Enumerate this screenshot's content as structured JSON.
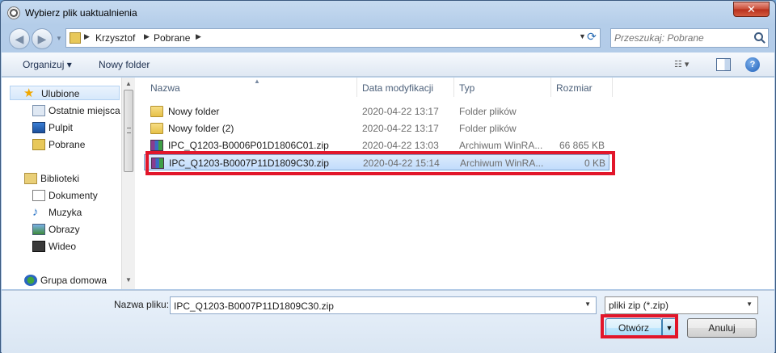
{
  "window": {
    "title": "Wybierz plik uaktualnienia",
    "close_label": "✕"
  },
  "navbar": {
    "back_icon": "back-arrow-icon",
    "forward_icon": "forward-arrow-icon",
    "breadcrumb": [
      "Krzysztof",
      "Pobrane"
    ],
    "search_placeholder": "Przeszukaj: Pobrane"
  },
  "toolbar": {
    "organize_label": "Organizuj ▾",
    "new_folder_label": "Nowy folder",
    "help_label": "?"
  },
  "sidebar": {
    "items": [
      {
        "label": "Ulubione",
        "icon": "star-icon",
        "selected": true
      },
      {
        "label": "Ostatnie miejsca",
        "icon": "recent-places-icon"
      },
      {
        "label": "Pulpit",
        "icon": "desktop-icon"
      },
      {
        "label": "Pobrane",
        "icon": "downloads-icon"
      },
      {
        "label": "Biblioteki",
        "icon": "libraries-icon"
      },
      {
        "label": "Dokumenty",
        "icon": "documents-icon"
      },
      {
        "label": "Muzyka",
        "icon": "music-icon"
      },
      {
        "label": "Obrazy",
        "icon": "pictures-icon"
      },
      {
        "label": "Wideo",
        "icon": "video-icon"
      },
      {
        "label": "Grupa domowa",
        "icon": "homegroup-icon"
      }
    ]
  },
  "files": {
    "columns": [
      "Nazwa",
      "Data modyfikacji",
      "Typ",
      "Rozmiar"
    ],
    "rows": [
      {
        "name": "Nowy folder",
        "date": "2020-04-22 13:17",
        "type": "Folder plików",
        "size": "",
        "icon": "folder-icon"
      },
      {
        "name": "Nowy folder (2)",
        "date": "2020-04-22 13:17",
        "type": "Folder plików",
        "size": "",
        "icon": "folder-icon"
      },
      {
        "name": "IPC_Q1203-B0006P01D1806C01.zip",
        "date": "2020-04-22 13:03",
        "type": "Archiwum WinRA...",
        "size": "66 865 KB",
        "icon": "winrar-archive-icon"
      },
      {
        "name": "IPC_Q1203-B0007P11D1809C30.zip",
        "date": "2020-04-22 15:14",
        "type": "Archiwum WinRA...",
        "size": "0 KB",
        "icon": "winrar-archive-icon",
        "selected": true
      }
    ]
  },
  "bottom": {
    "filename_label": "Nazwa pliku:",
    "filename_value": "IPC_Q1203-B0007P11D1809C30.zip",
    "filetype_value": "pliki zip (*.zip)",
    "open_label": "Otwórz",
    "cancel_label": "Anuluj"
  }
}
